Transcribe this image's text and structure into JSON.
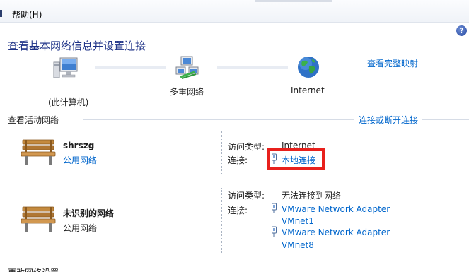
{
  "menu": {
    "help": "帮助(H)"
  },
  "page_title": "查看基本网络信息并设置连接",
  "map": {
    "computer_label": "(此计算机)",
    "network_label": "多重网络",
    "internet_label": "Internet",
    "full_map_link": "查看完整映射"
  },
  "active_section": {
    "label": "查看活动网络",
    "connect_link": "连接或断开连接"
  },
  "networks": [
    {
      "name": "shrszg",
      "type_link": "公用网络",
      "access_type_label": "访问类型:",
      "access_type_value": "Internet",
      "connection_label": "连接:",
      "connections": [
        "本地连接"
      ]
    },
    {
      "name": "未识别的网络",
      "type_text": "公用网络",
      "access_type_label": "访问类型:",
      "access_type_value": "无法连接到网络",
      "connection_label": "连接:",
      "connections": [
        "VMware Network Adapter VMnet1",
        "VMware Network Adapter VMnet8"
      ]
    }
  ],
  "adapter_lines": {
    "vmnet1_a": "VMware Network Adapter",
    "vmnet1_b": "VMnet1",
    "vmnet8_a": "VMware Network Adapter",
    "vmnet8_b": "VMnet8"
  },
  "bottom_section": {
    "label": "更改网络设置"
  },
  "colors": {
    "link": "#0066cc",
    "title": "#1e3287",
    "highlight": "#e8201c"
  }
}
